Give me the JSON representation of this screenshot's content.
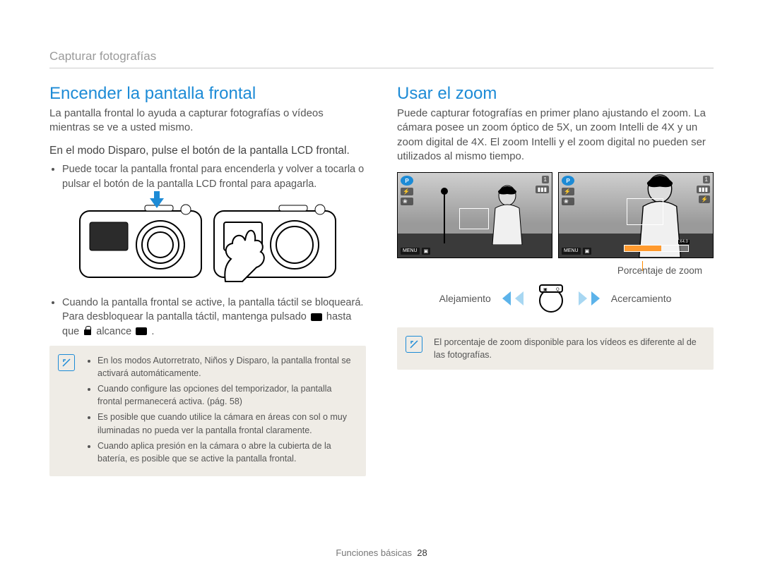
{
  "breadcrumb": "Capturar fotografías",
  "left": {
    "title": "Encender la pantalla frontal",
    "lead": "La pantalla frontal lo ayuda a capturar fotografías o vídeos mientras se ve a usted mismo.",
    "sub": "En el modo Disparo, pulse el botón de la pantalla LCD frontal.",
    "bullet1": "Puede tocar la pantalla frontal para encenderla y volver a tocarla o pulsar el botón de la pantalla LCD frontal para apagarla.",
    "after_para_a": "Cuando la pantalla frontal se active, la pantalla táctil se bloqueará. Para desbloquear la pantalla táctil, mantenga pulsado ",
    "after_para_b": " hasta que ",
    "after_para_c": " alcance ",
    "after_para_d": ".",
    "note1": "En los modos Autorretrato, Niños y Disparo, la pantalla frontal se activará automáticamente.",
    "note2": "Cuando configure las opciones del temporizador, la pantalla frontal permanecerá activa. (pág. 58)",
    "note3": "Es posible que cuando utilice la cámara en áreas con sol o muy iluminadas no pueda ver la pantalla frontal claramente.",
    "note4": "Cuando aplica presión en la cámara o abre la cubierta de la batería, es posible que se active la pantalla frontal."
  },
  "right": {
    "title": "Usar el zoom",
    "lead": "Puede capturar fotografías en primer plano ajustando el zoom. La cámara posee un zoom óptico de 5X, un zoom Intelli de 4X y un zoom digital de 4X. El zoom Intelli y el zoom digital no pueden ser utilizados al mismo tiempo.",
    "zoom_label": "Porcentaje de zoom",
    "zoom_out": "Alejamiento",
    "zoom_in": "Acercamiento",
    "note": "El porcentaje de zoom disponible para los vídeos es diferente al de las fotografías.",
    "hud": {
      "p": "P",
      "count": "1",
      "menu": "MENU",
      "zoom_tag": "X4.0"
    }
  },
  "footer": {
    "section": "Funciones básicas",
    "page": "28"
  }
}
